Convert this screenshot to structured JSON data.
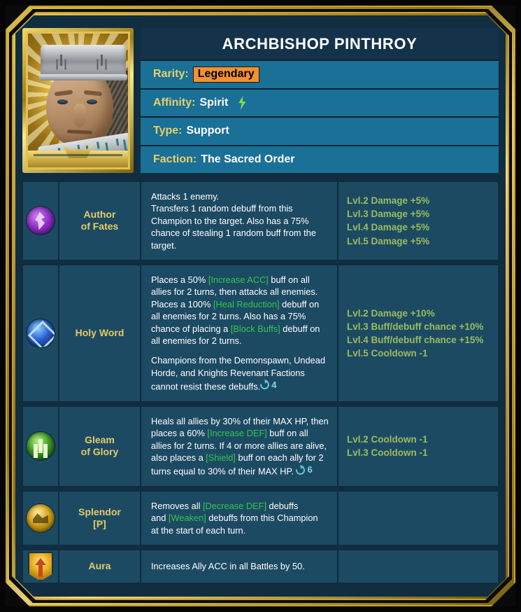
{
  "champion": {
    "name": "ARCHBISHOP PINTHROY",
    "portrait_icon": "champion-portrait-archbishop",
    "stats": [
      {
        "label": "Rarity:",
        "value": "Legendary",
        "style": "legendary"
      },
      {
        "label": "Affinity:",
        "value": "Spirit",
        "icon": "spirit-affinity-icon",
        "icon_color": "#86e04a"
      },
      {
        "label": "Type:",
        "value": "Support"
      },
      {
        "label": "Faction:",
        "value": "The Sacred Order"
      }
    ]
  },
  "colors": {
    "panel_bg": "#112d40",
    "row_bg": "#1d4a63",
    "stat_row_bg": "#1a7096",
    "title_bg": "#14324a",
    "gold_text": "#e5cb68",
    "levelup_text": "#9bbc5e",
    "buff_tag": "#31c74e",
    "cooldown_cyan": "#7fd8e8",
    "legendary_bg": "#f2912e",
    "frame_gold": "#c9a227"
  },
  "skills": [
    {
      "icon": "skill-icon-author-of-fates",
      "name": "Author\nof Fates",
      "desc_parts": [
        {
          "t": "Attacks 1 enemy."
        },
        {
          "br": true
        },
        {
          "t": "Transfers 1 random debuff from this Champion to the target. Also has a 75% chance of stealing 1 random buff from the target."
        }
      ],
      "levelups": [
        "Lvl.2 Damage +5%",
        "Lvl.3 Damage +5%",
        "Lvl.4 Damage +5%",
        "Lvl.5 Damage +5%"
      ]
    },
    {
      "icon": "skill-icon-holy-word",
      "name": "Holy Word",
      "desc_parts": [
        {
          "t": "Places a 50% "
        },
        {
          "t": "[Increase ACC]",
          "tag": true
        },
        {
          "t": " buff on all allies for 2 turns, then attacks all enemies."
        },
        {
          "br": true
        },
        {
          "t": "Places a 100% "
        },
        {
          "t": "[Heal Reduction]",
          "tag": true
        },
        {
          "t": " debuff on all enemies for 2 turns. Also has a 75% chance of placing a "
        },
        {
          "t": "[Block Buffs]",
          "tag": true
        },
        {
          "t": " debuff on all enemies for 2 turns."
        },
        {
          "gap": true
        },
        {
          "t": "Champions from the Demonspawn, Undead Horde, and Knights Revenant Factions cannot resist these debuffs."
        },
        {
          "cd": "4"
        }
      ],
      "levelups": [
        "Lvl.2 Damage +10%",
        "Lvl.3 Buff/debuff chance +10%",
        "Lvl.4 Buff/debuff chance +15%",
        "Lvl.5 Cooldown -1"
      ]
    },
    {
      "icon": "skill-icon-gleam-of-glory",
      "name": "Gleam\nof Glory",
      "desc_parts": [
        {
          "t": "Heals all allies by 30% of their MAX HP, then places a 60% "
        },
        {
          "t": "[Increase DEF]",
          "tag": true
        },
        {
          "t": " buff on all allies for 2 turns. If 4 or more allies are alive, also places a "
        },
        {
          "t": "[Shield]",
          "tag": true
        },
        {
          "t": " buff on each ally for 2 turns equal to 30% of their MAX HP. "
        },
        {
          "cd": "6"
        }
      ],
      "levelups": [
        "Lvl.2 Cooldown -1",
        "Lvl.3 Cooldown -1"
      ]
    },
    {
      "icon": "skill-icon-splendor",
      "name": "Splendor\n[P]",
      "desc_parts": [
        {
          "t": "Removes all "
        },
        {
          "t": "[Decrease DEF]",
          "tag": true
        },
        {
          "t": " debuffs"
        },
        {
          "br": true
        },
        {
          "t": "and "
        },
        {
          "t": "[Weaken]",
          "tag": true
        },
        {
          "t": " debuffs from this Champion"
        },
        {
          "br": true
        },
        {
          "t": "at the start of each turn."
        }
      ],
      "levelups": []
    }
  ],
  "aura": {
    "icon": "aura-banner-icon",
    "name": "Aura",
    "description": "Increases Ally ACC in all Battles by 50."
  }
}
